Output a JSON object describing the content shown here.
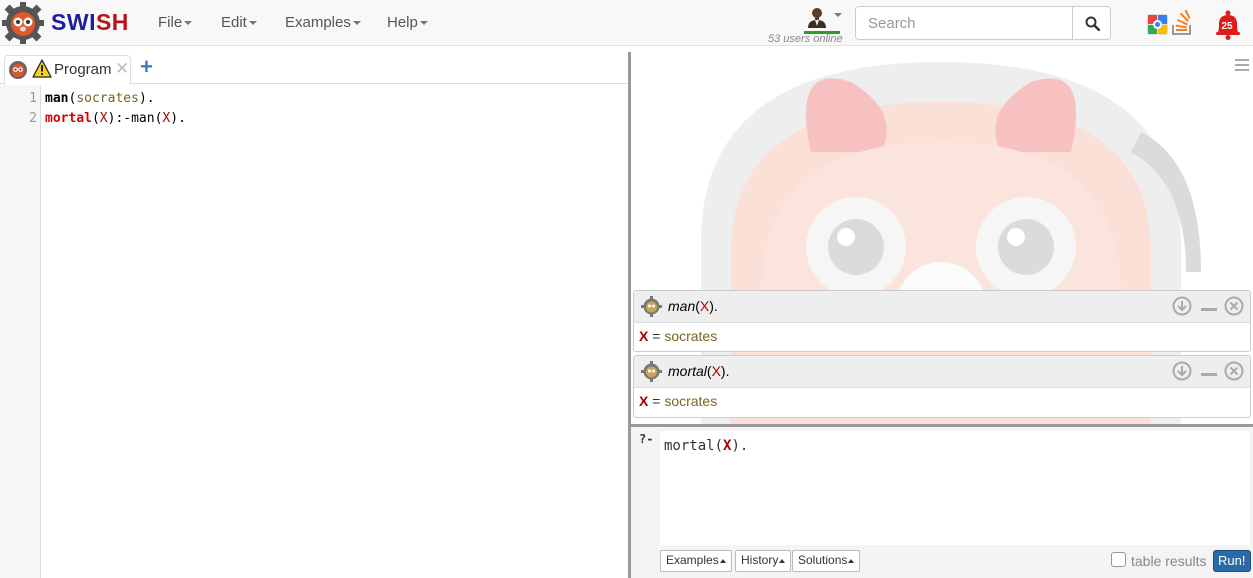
{
  "navbar": {
    "brand": {
      "sw": "SW",
      "i": "I",
      "sh": "SH"
    },
    "menus": [
      "File",
      "Edit",
      "Examples",
      "Help"
    ],
    "users_online": "53 users online",
    "search_placeholder": "Search",
    "notification_count": "25"
  },
  "editor": {
    "tab_label": "Program",
    "tab_close": "✕",
    "tab_add": "+",
    "line_numbers": [
      "1",
      "2"
    ],
    "line1": {
      "head": "man",
      "open": "(",
      "arg": "socrates",
      "close": ")."
    },
    "line2": {
      "head": "mortal",
      "open": "(",
      "var1": "X",
      "mid": "):-man(",
      "var2": "X",
      "close": ")."
    }
  },
  "answers": [
    {
      "query_pred": "man",
      "query_open": "(",
      "query_var": "X",
      "query_close": ").",
      "var": "X",
      "eq": " = ",
      "value": "socrates"
    },
    {
      "query_pred": "mortal",
      "query_open": "(",
      "query_var": "X",
      "query_close": ").",
      "var": "X",
      "eq": " = ",
      "value": "socrates"
    }
  ],
  "query": {
    "prompt": "?-",
    "text_pred": "mortal(",
    "text_var": "X",
    "text_close": ").",
    "buttons": [
      "Examples",
      "History",
      "Solutions"
    ],
    "table_results_label": "table results",
    "run_label": "Run!"
  },
  "colors": {
    "brand_blue": "#1e1e9e",
    "brand_red": "#b5151b",
    "run_button": "#2a6aa7",
    "prolog_variable": "#aa0000",
    "prolog_atom": "#776622"
  }
}
